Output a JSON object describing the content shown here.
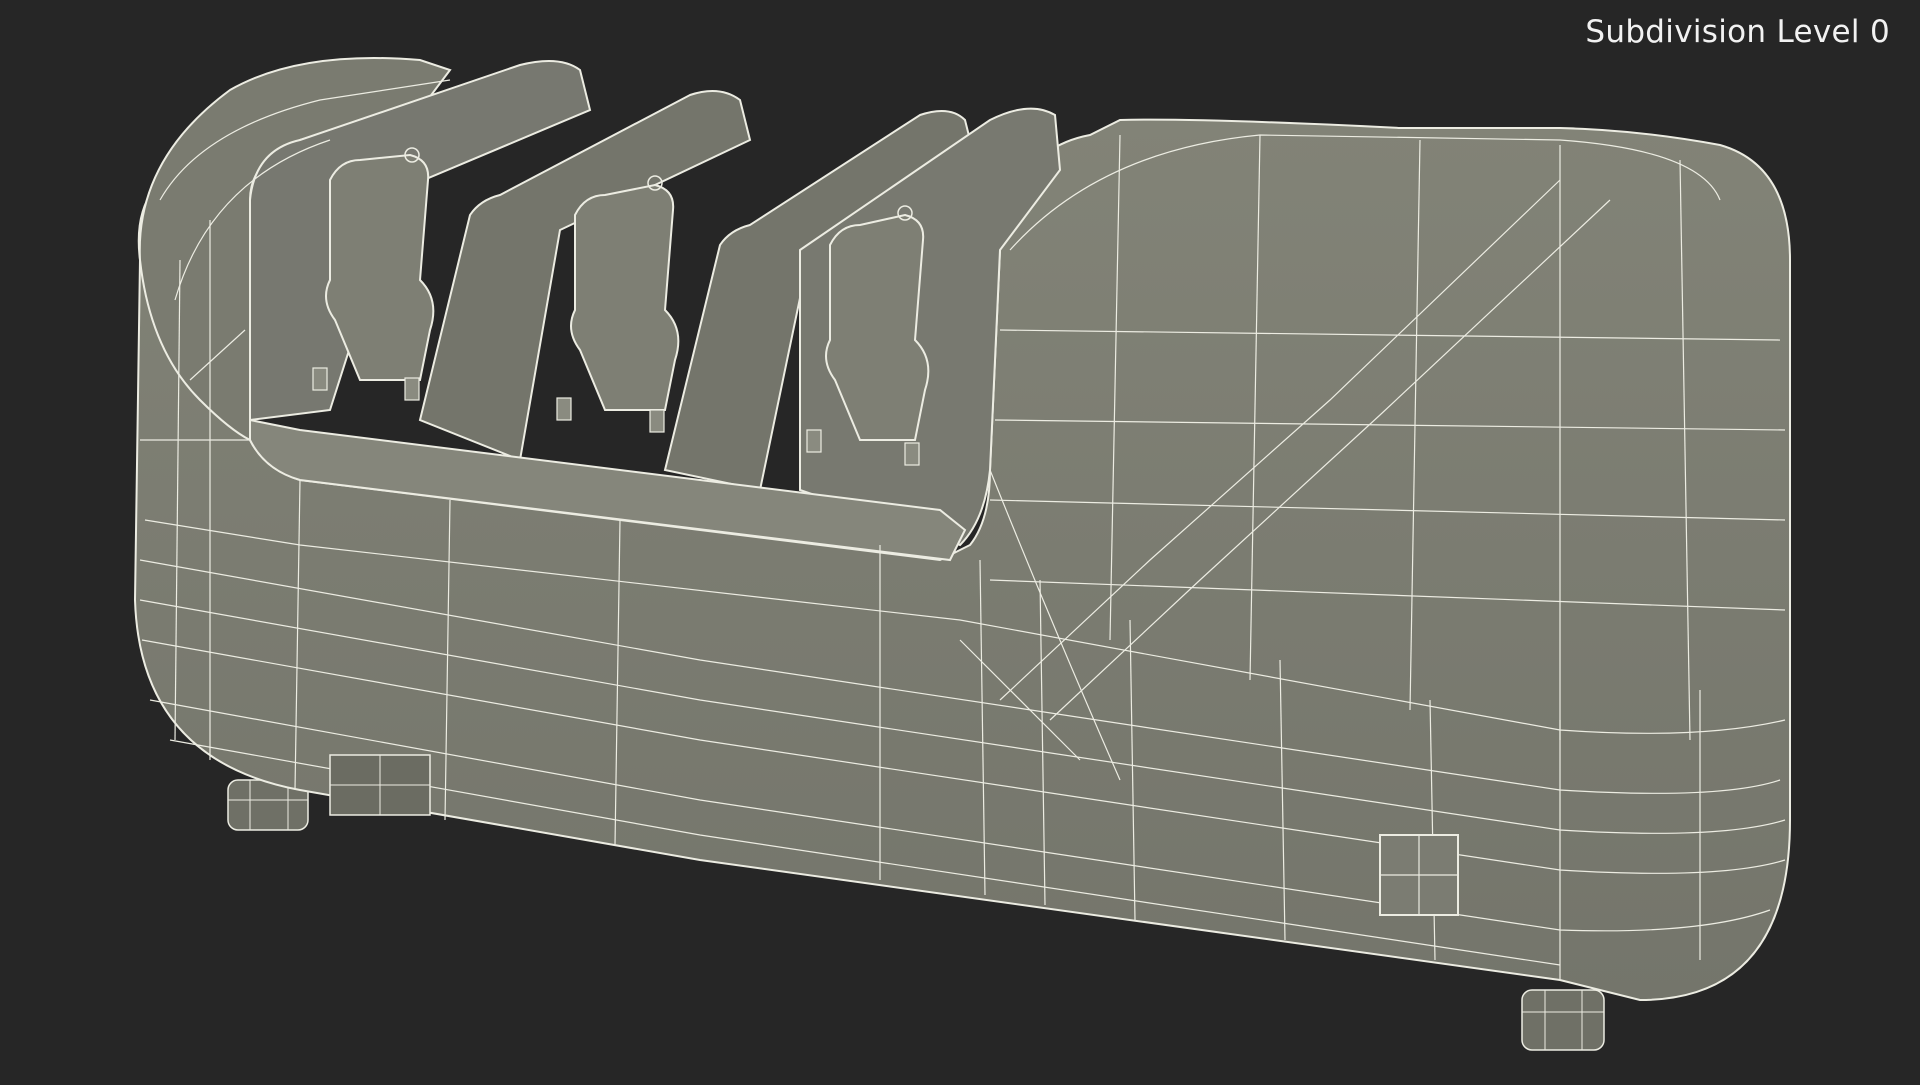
{
  "viewport": {
    "overlay_label": "Subdivision Level 0",
    "object": "wireframe-electric-knife-sharpener",
    "colors": {
      "background": "#262626",
      "surface": "#7c7d72",
      "surface_dark": "#6a6b61",
      "surface_light": "#8a8b80",
      "wire": "#ecece2",
      "label": "#f2f2f2"
    }
  }
}
